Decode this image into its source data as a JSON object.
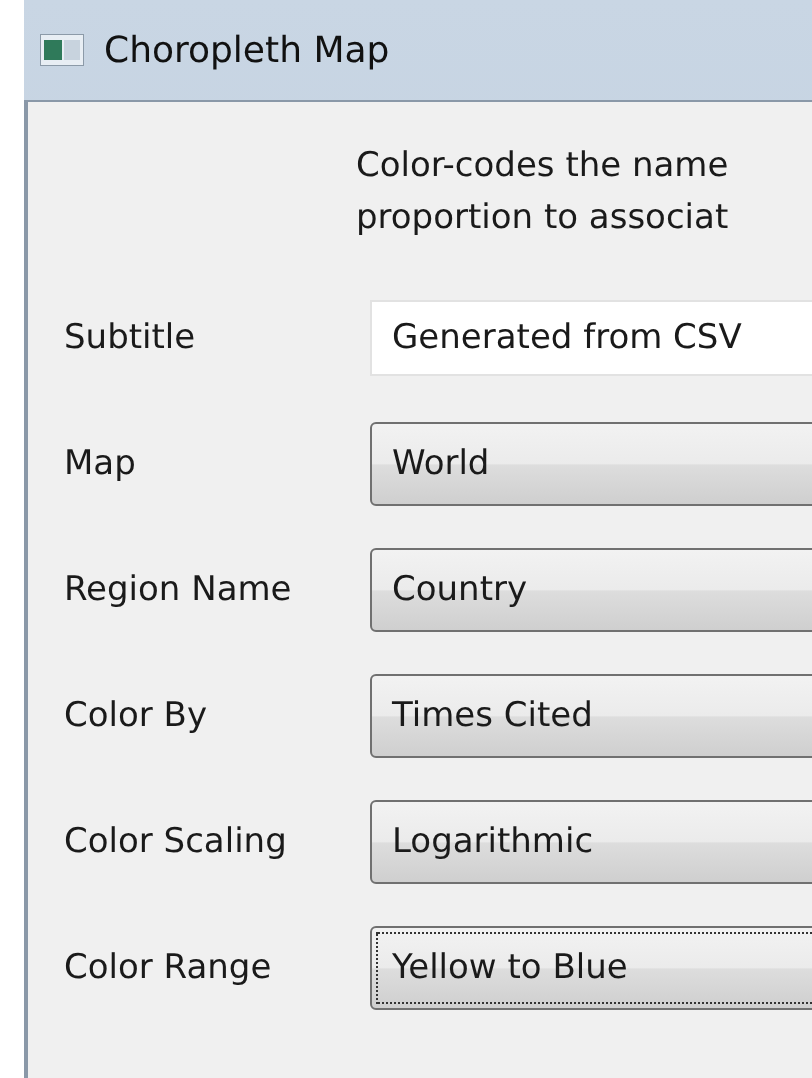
{
  "window": {
    "title": "Choropleth Map"
  },
  "description": [
    "Color-codes the name",
    "proportion to associat"
  ],
  "fields": [
    {
      "label": "Subtitle",
      "kind": "text",
      "value": "Generated from CSV",
      "focused": false
    },
    {
      "label": "Map",
      "kind": "combo",
      "value": "World",
      "focused": false
    },
    {
      "label": "Region Name",
      "kind": "combo",
      "value": "Country",
      "focused": false
    },
    {
      "label": "Color By",
      "kind": "combo",
      "value": "Times Cited",
      "focused": false
    },
    {
      "label": "Color Scaling",
      "kind": "combo",
      "value": "Logarithmic",
      "focused": false
    },
    {
      "label": "Color Range",
      "kind": "combo",
      "value": "Yellow to Blue",
      "focused": true
    }
  ]
}
